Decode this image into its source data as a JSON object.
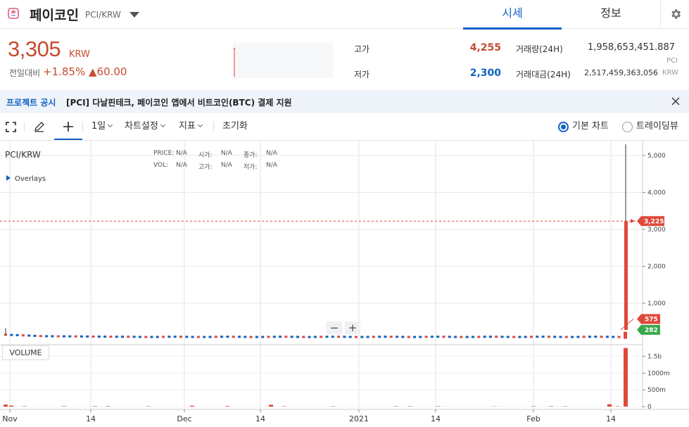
{
  "header": {
    "coin_name": "페이코인",
    "pair": "PCI/KRW",
    "tabs": [
      {
        "label": "시세",
        "active": true
      },
      {
        "label": "정보",
        "active": false
      }
    ],
    "settings_icon": "gear-icon"
  },
  "ticker": {
    "price": "3,305",
    "price_unit": "KRW",
    "prev_label": "전일대비",
    "change_rate": "+1.85%",
    "change_amount": "▲60.00",
    "high_label": "고가",
    "high": "4,255",
    "low_label": "저가",
    "low": "2,300",
    "volume_label": "거래량(24H)",
    "volume": "1,958,653,451.887",
    "volume_unit": "PCI",
    "value_label": "거래대금(24H)",
    "value": "2,517,459,363,056",
    "value_unit": "KRW"
  },
  "notice": {
    "tag": "프로젝트 공시",
    "text": "[PCI] 다날핀테크, 페이코인 앱에서 비트코인(BTC) 결제 지원"
  },
  "toolbar": {
    "interval": "1일",
    "chart_settings": "차트설정",
    "indicators": "지표",
    "reset": "초기화",
    "chart_basic": "기본 차트",
    "chart_tradingview": "트레이딩뷰"
  },
  "chart_info": {
    "pair": "PCI/KRW",
    "row1": [
      [
        "PRICE:",
        "N/A"
      ],
      [
        "시가:",
        "N/A"
      ],
      [
        "종가:",
        "N/A"
      ]
    ],
    "row2": [
      [
        "VOL:",
        "N/A"
      ],
      [
        "고가:",
        "N/A"
      ],
      [
        "저가:",
        "N/A"
      ]
    ],
    "overlays": "Overlays",
    "volume_btn": "VOLUME"
  },
  "chart_data": {
    "type": "candlestick",
    "x_ticks": [
      "Nov",
      "14",
      "Dec",
      "14",
      "2021",
      "14",
      "Feb",
      "14"
    ],
    "price_axis": [
      "5,000",
      "4,000",
      "3,000",
      "2,000",
      "1,000"
    ],
    "price_ticks": [
      5000,
      4000,
      3000,
      2000,
      1000
    ],
    "price_range": [
      -120,
      5400
    ],
    "volume_axis": [
      "1.5b",
      "1000m",
      "500m",
      "0"
    ],
    "volume_ticks": [
      1500000000,
      1000000000,
      500000000,
      0
    ],
    "volume_range": [
      0,
      1850000000
    ],
    "last_price_label": "3,225",
    "last_price": 3225,
    "markers": [
      {
        "label": "575",
        "value": 575,
        "color": "#e0483a"
      },
      {
        "label": "282",
        "value": 282,
        "color": "#3aa84a"
      }
    ],
    "grid": true,
    "up_color": "#e0483a",
    "down_color": "#1261c4"
  }
}
